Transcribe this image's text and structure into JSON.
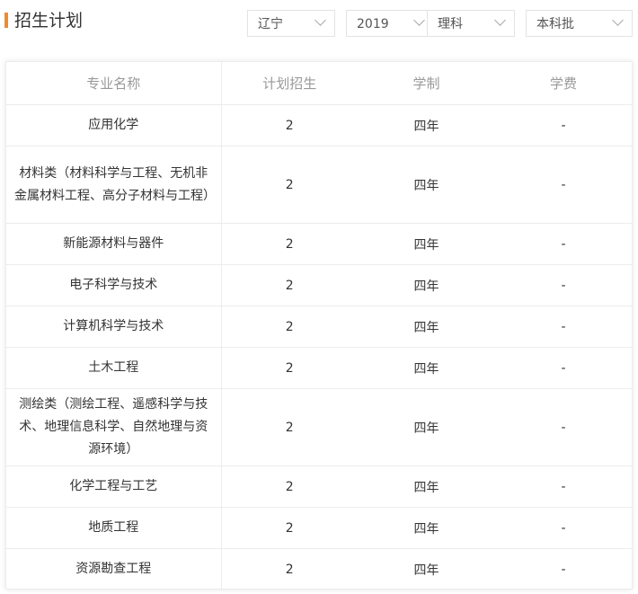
{
  "header": {
    "title": "招生计划"
  },
  "filters": {
    "province": "辽宁",
    "year": "2019",
    "subject": "理科",
    "batch": "本科批"
  },
  "table": {
    "headers": [
      "专业名称",
      "计划招生",
      "学制",
      "学费"
    ],
    "rows": [
      {
        "name": "应用化学",
        "plan": "2",
        "duration": "四年",
        "fee": "-"
      },
      {
        "name": "材料类（材料科学与工程、无机非金属材料工程、高分子材料与工程）",
        "plan": "2",
        "duration": "四年",
        "fee": "-"
      },
      {
        "name": "新能源材料与器件",
        "plan": "2",
        "duration": "四年",
        "fee": "-"
      },
      {
        "name": "电子科学与技术",
        "plan": "2",
        "duration": "四年",
        "fee": "-"
      },
      {
        "name": "计算机科学与技术",
        "plan": "2",
        "duration": "四年",
        "fee": "-"
      },
      {
        "name": "土木工程",
        "plan": "2",
        "duration": "四年",
        "fee": "-"
      },
      {
        "name": "测绘类（测绘工程、遥感科学与技术、地理信息科学、自然地理与资源环境）",
        "plan": "2",
        "duration": "四年",
        "fee": "-"
      },
      {
        "name": "化学工程与工艺",
        "plan": "2",
        "duration": "四年",
        "fee": "-"
      },
      {
        "name": "地质工程",
        "plan": "2",
        "duration": "四年",
        "fee": "-"
      },
      {
        "name": "资源勘查工程",
        "plan": "2",
        "duration": "四年",
        "fee": "-"
      }
    ]
  },
  "colors": {
    "accent": "#f08a2f",
    "border": "#ececec",
    "header_text": "#999999"
  }
}
